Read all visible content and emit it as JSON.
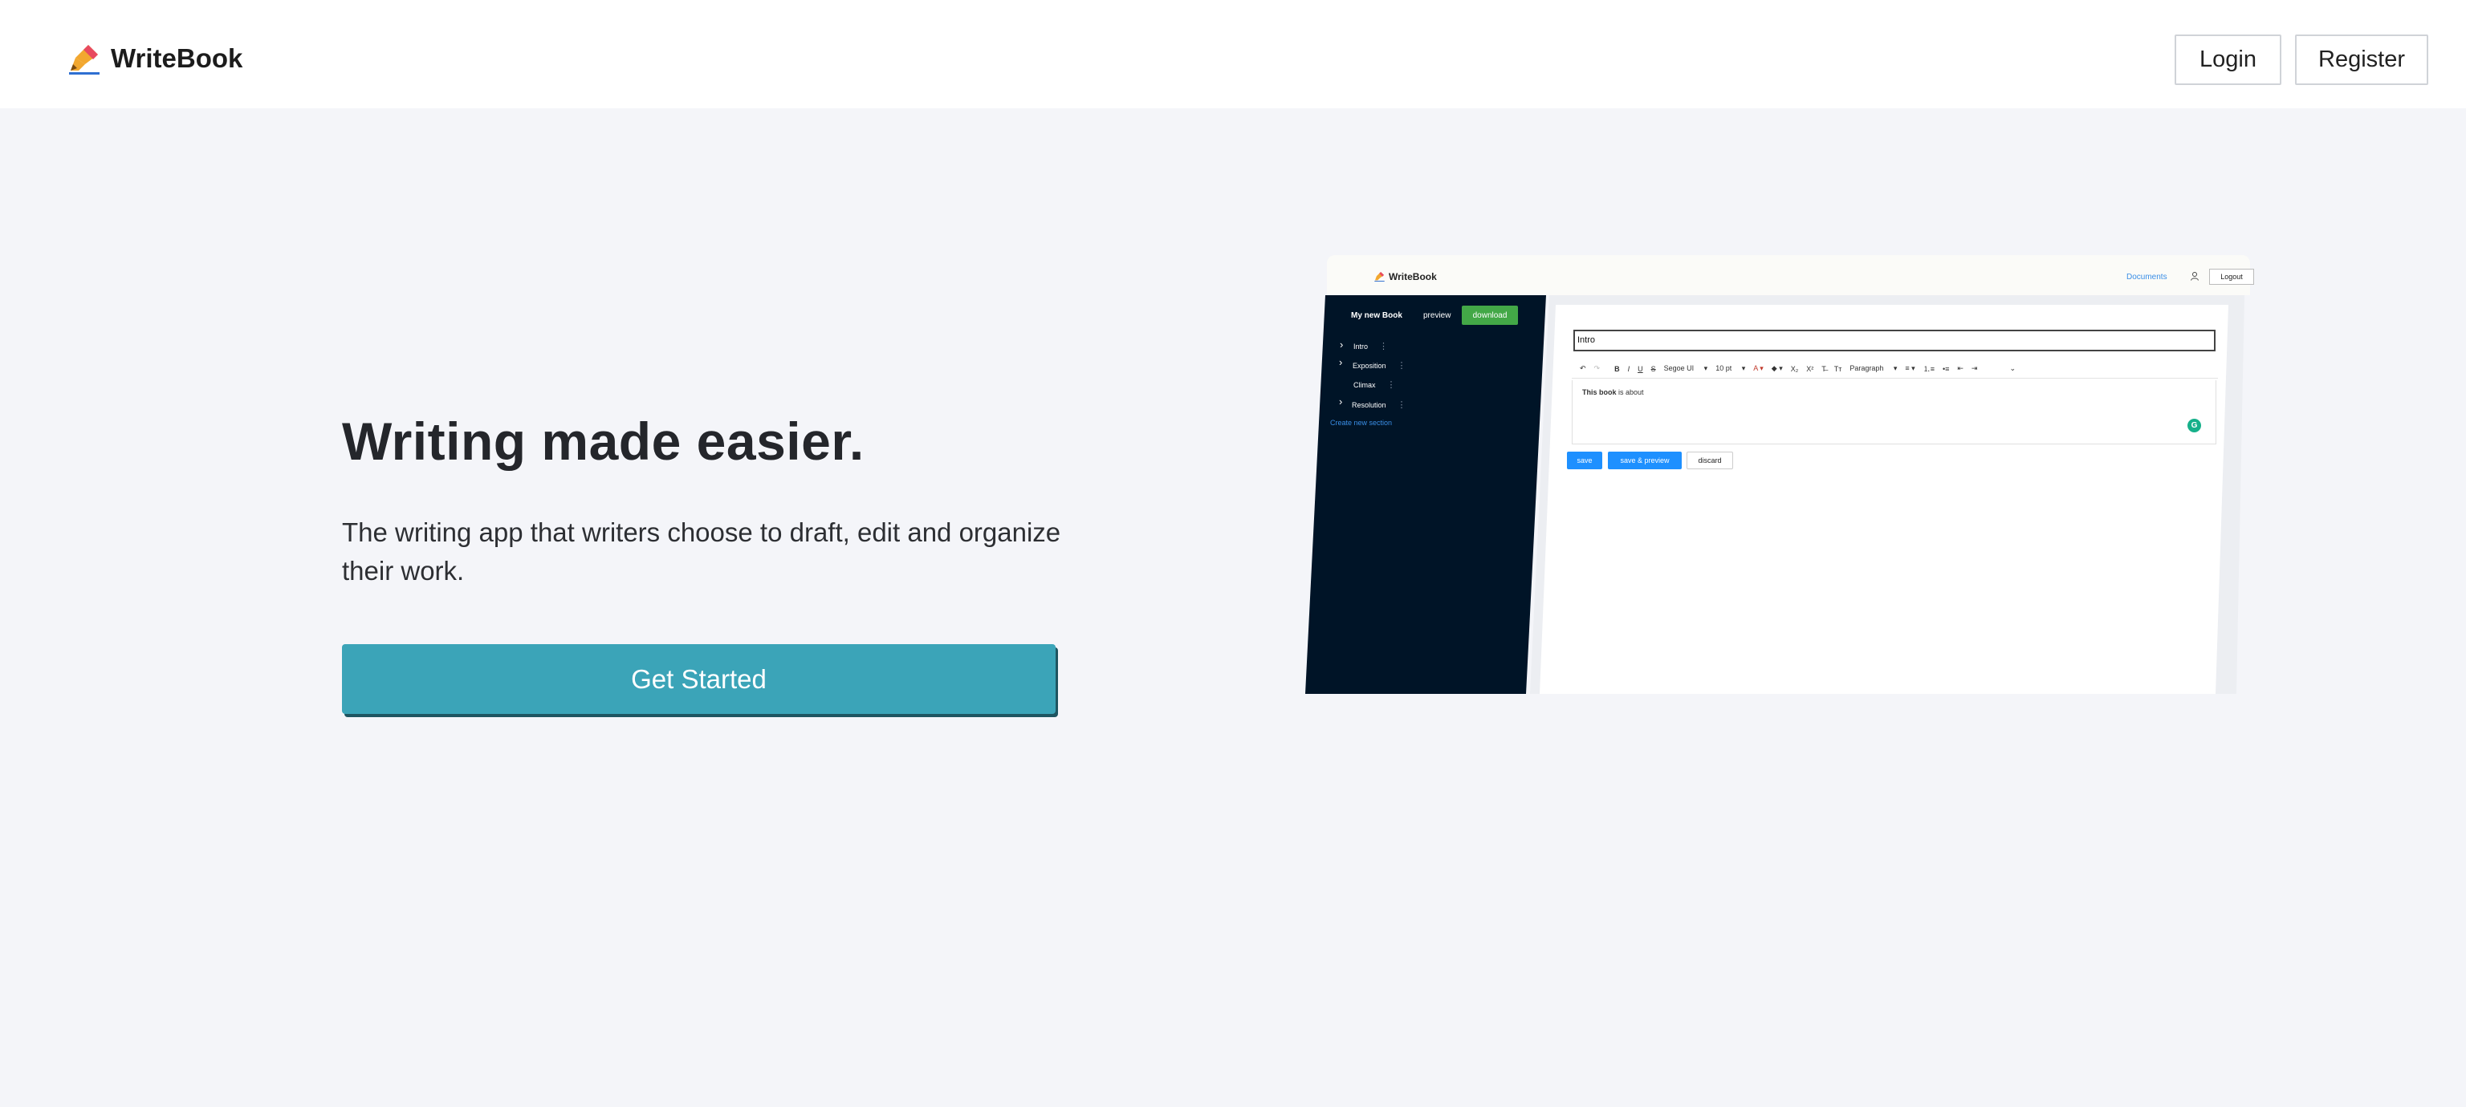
{
  "header": {
    "brand": "WriteBook",
    "login_label": "Login",
    "register_label": "Register"
  },
  "hero": {
    "title": "Writing made easier.",
    "subtitle": "The writing app that writers choose to draft, edit and organize their work.",
    "cta_label": "Get Started"
  },
  "mockup": {
    "brand": "WriteBook",
    "documents_link": "Documents",
    "logout_label": "Logout",
    "book_title": "My new Book",
    "preview_label": "preview",
    "download_label": "download",
    "sections": [
      {
        "label": "Intro",
        "expandable": true
      },
      {
        "label": "Exposition",
        "expandable": true
      },
      {
        "label": "Climax",
        "expandable": false
      },
      {
        "label": "Resolution",
        "expandable": true
      }
    ],
    "create_section_label": "Create new section",
    "section_title_value": "Intro",
    "toolbar": {
      "font_family": "Segoe UI",
      "font_size": "10 pt",
      "block_format": "Paragraph"
    },
    "content_bold": "This book",
    "content_rest": " is about",
    "save_label": "save",
    "save_preview_label": "save & preview",
    "discard_label": "discard"
  },
  "colors": {
    "accent": "#3ba4b8",
    "sidebar": "#001427",
    "download": "#43a847",
    "primary_button": "#1e90ff",
    "page_background": "#f4f5f9"
  }
}
